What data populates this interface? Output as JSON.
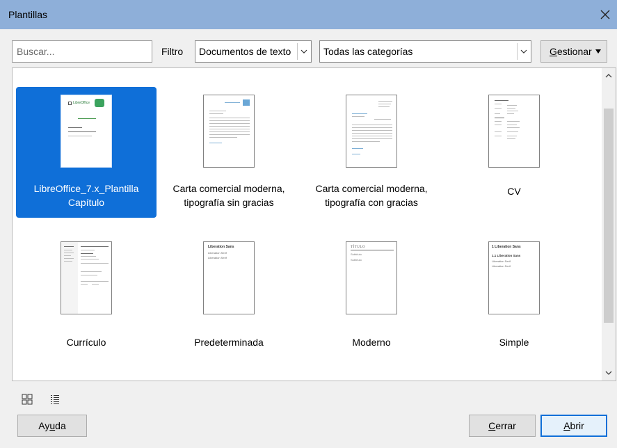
{
  "window": {
    "title": "Plantillas"
  },
  "toolbar": {
    "search_placeholder": "Buscar...",
    "filter_label": "Filtro",
    "document_type": "Documentos de texto",
    "category": "Todas las categorías",
    "manage_prefix": "",
    "manage_underlined": "G",
    "manage_rest": "estionar"
  },
  "templates": [
    {
      "line1": "LibreOffice_7.x_Plantilla",
      "line2": "Capítulo",
      "selected": true
    },
    {
      "line1": "Carta comercial moderna,",
      "line2": "tipografía sin gracias"
    },
    {
      "line1": "Carta comercial moderna,",
      "line2": "tipografía con gracias"
    },
    {
      "line1": "CV",
      "line2": ""
    },
    {
      "line1": "Currículo",
      "line2": ""
    },
    {
      "line1": "Predeterminada",
      "line2": ""
    },
    {
      "line1": "Moderno",
      "line2": ""
    },
    {
      "line1": "Simple",
      "line2": ""
    }
  ],
  "previews": {
    "logo_text": "LibreOffice",
    "liberation_sans": "Liberation Sans",
    "liberation_serif": "Liberation Serif",
    "heading1": "1   Liberation Sans",
    "heading2": "1.1  Liberation Sans",
    "moderno_title": "TÍTULO",
    "moderno_sub": "Subtítulo"
  },
  "buttons": {
    "help_prefix": "Ay",
    "help_underlined": "u",
    "help_rest": "da",
    "close_underlined": "C",
    "close_rest": "errar",
    "open_underlined": "A",
    "open_rest": "brir"
  },
  "colors": {
    "titlebar": "#8eafd9",
    "selection": "#0f6fd8"
  },
  "icons": [
    "close-icon",
    "chevron-down-icon",
    "caret-down-icon",
    "scroll-up-icon",
    "scroll-down-icon",
    "thumbnail-view-icon",
    "list-view-icon"
  ]
}
